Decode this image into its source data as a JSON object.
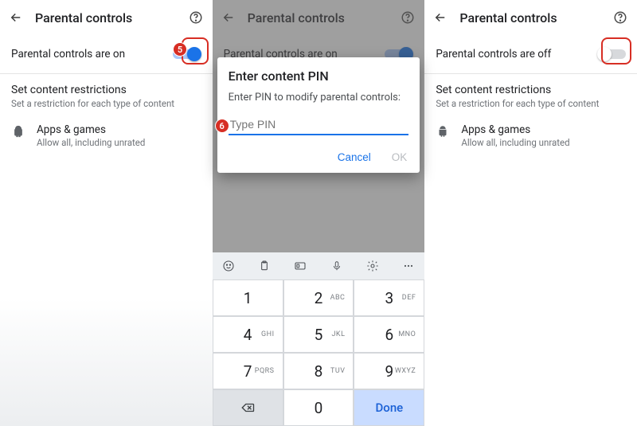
{
  "panel1": {
    "title": "Parental controls",
    "toggle_label": "Parental controls are on",
    "section_title": "Set content restrictions",
    "section_sub": "Set a restriction for each type of content",
    "item_title": "Apps & games",
    "item_sub": "Allow all, including unrated",
    "badge": "5"
  },
  "panel2": {
    "title": "Parental controls",
    "toggle_label": "Parental controls are on",
    "dialog_title": "Enter content PIN",
    "dialog_msg": "Enter PIN to modify parental controls:",
    "pin_placeholder": "Type PIN",
    "cancel": "Cancel",
    "ok": "OK",
    "badge": "6",
    "keyboard": {
      "keys": [
        {
          "n": "1",
          "l": ""
        },
        {
          "n": "2",
          "l": "ABC"
        },
        {
          "n": "3",
          "l": "DEF"
        },
        {
          "n": "4",
          "l": "GHI"
        },
        {
          "n": "5",
          "l": "JKL"
        },
        {
          "n": "6",
          "l": "MNO"
        },
        {
          "n": "7",
          "l": "PQRS"
        },
        {
          "n": "8",
          "l": "TUV"
        },
        {
          "n": "9",
          "l": "WXYZ"
        },
        {
          "n": "",
          "l": ""
        },
        {
          "n": "0",
          "l": ""
        },
        {
          "n": "Done",
          "l": ""
        }
      ]
    }
  },
  "panel3": {
    "title": "Parental controls",
    "toggle_label": "Parental controls are off",
    "section_title": "Set content restrictions",
    "section_sub": "Set a restriction for each type of content",
    "item_title": "Apps & games",
    "item_sub": "Allow all, including unrated"
  }
}
